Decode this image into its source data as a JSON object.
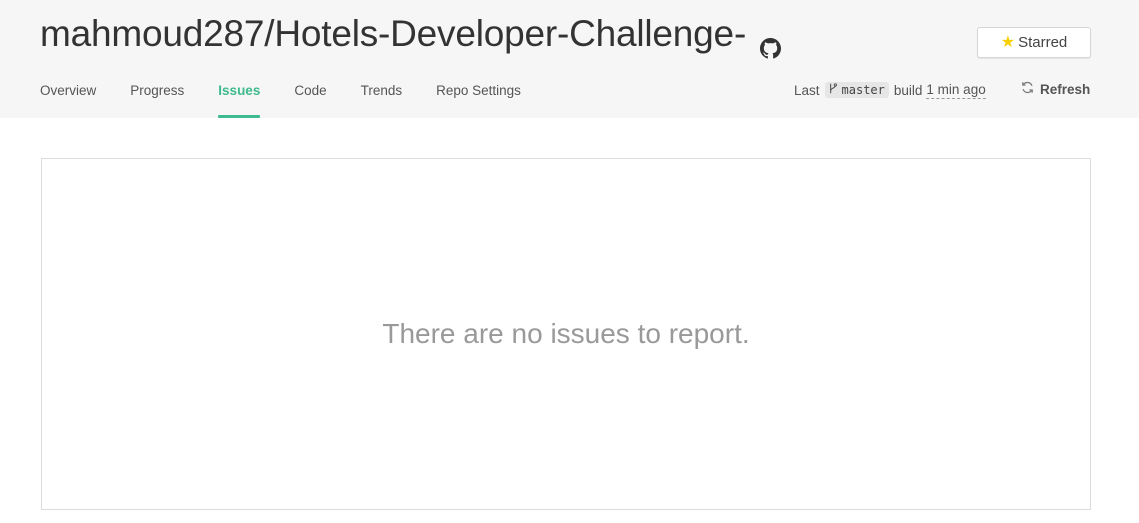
{
  "repo": {
    "title": "mahmoud287/Hotels-Developer-Challenge-",
    "icon": "github-icon"
  },
  "star_button": {
    "label": "Starred",
    "icon": "star-icon",
    "star_color": "#f5d100"
  },
  "tabs": [
    {
      "label": "Overview",
      "active": false
    },
    {
      "label": "Progress",
      "active": false
    },
    {
      "label": "Issues",
      "active": true
    },
    {
      "label": "Code",
      "active": false
    },
    {
      "label": "Trends",
      "active": false
    },
    {
      "label": "Repo Settings",
      "active": false
    }
  ],
  "build": {
    "prefix": "Last",
    "branch_icon": "branch-icon",
    "branch": "master",
    "middle": "build",
    "time": "1 min ago"
  },
  "refresh": {
    "label": "Refresh",
    "icon": "refresh-icon"
  },
  "main": {
    "empty_message": "There are no issues to report."
  },
  "colors": {
    "accent": "#3dbb8e",
    "header_bg": "#f6f6f6"
  }
}
